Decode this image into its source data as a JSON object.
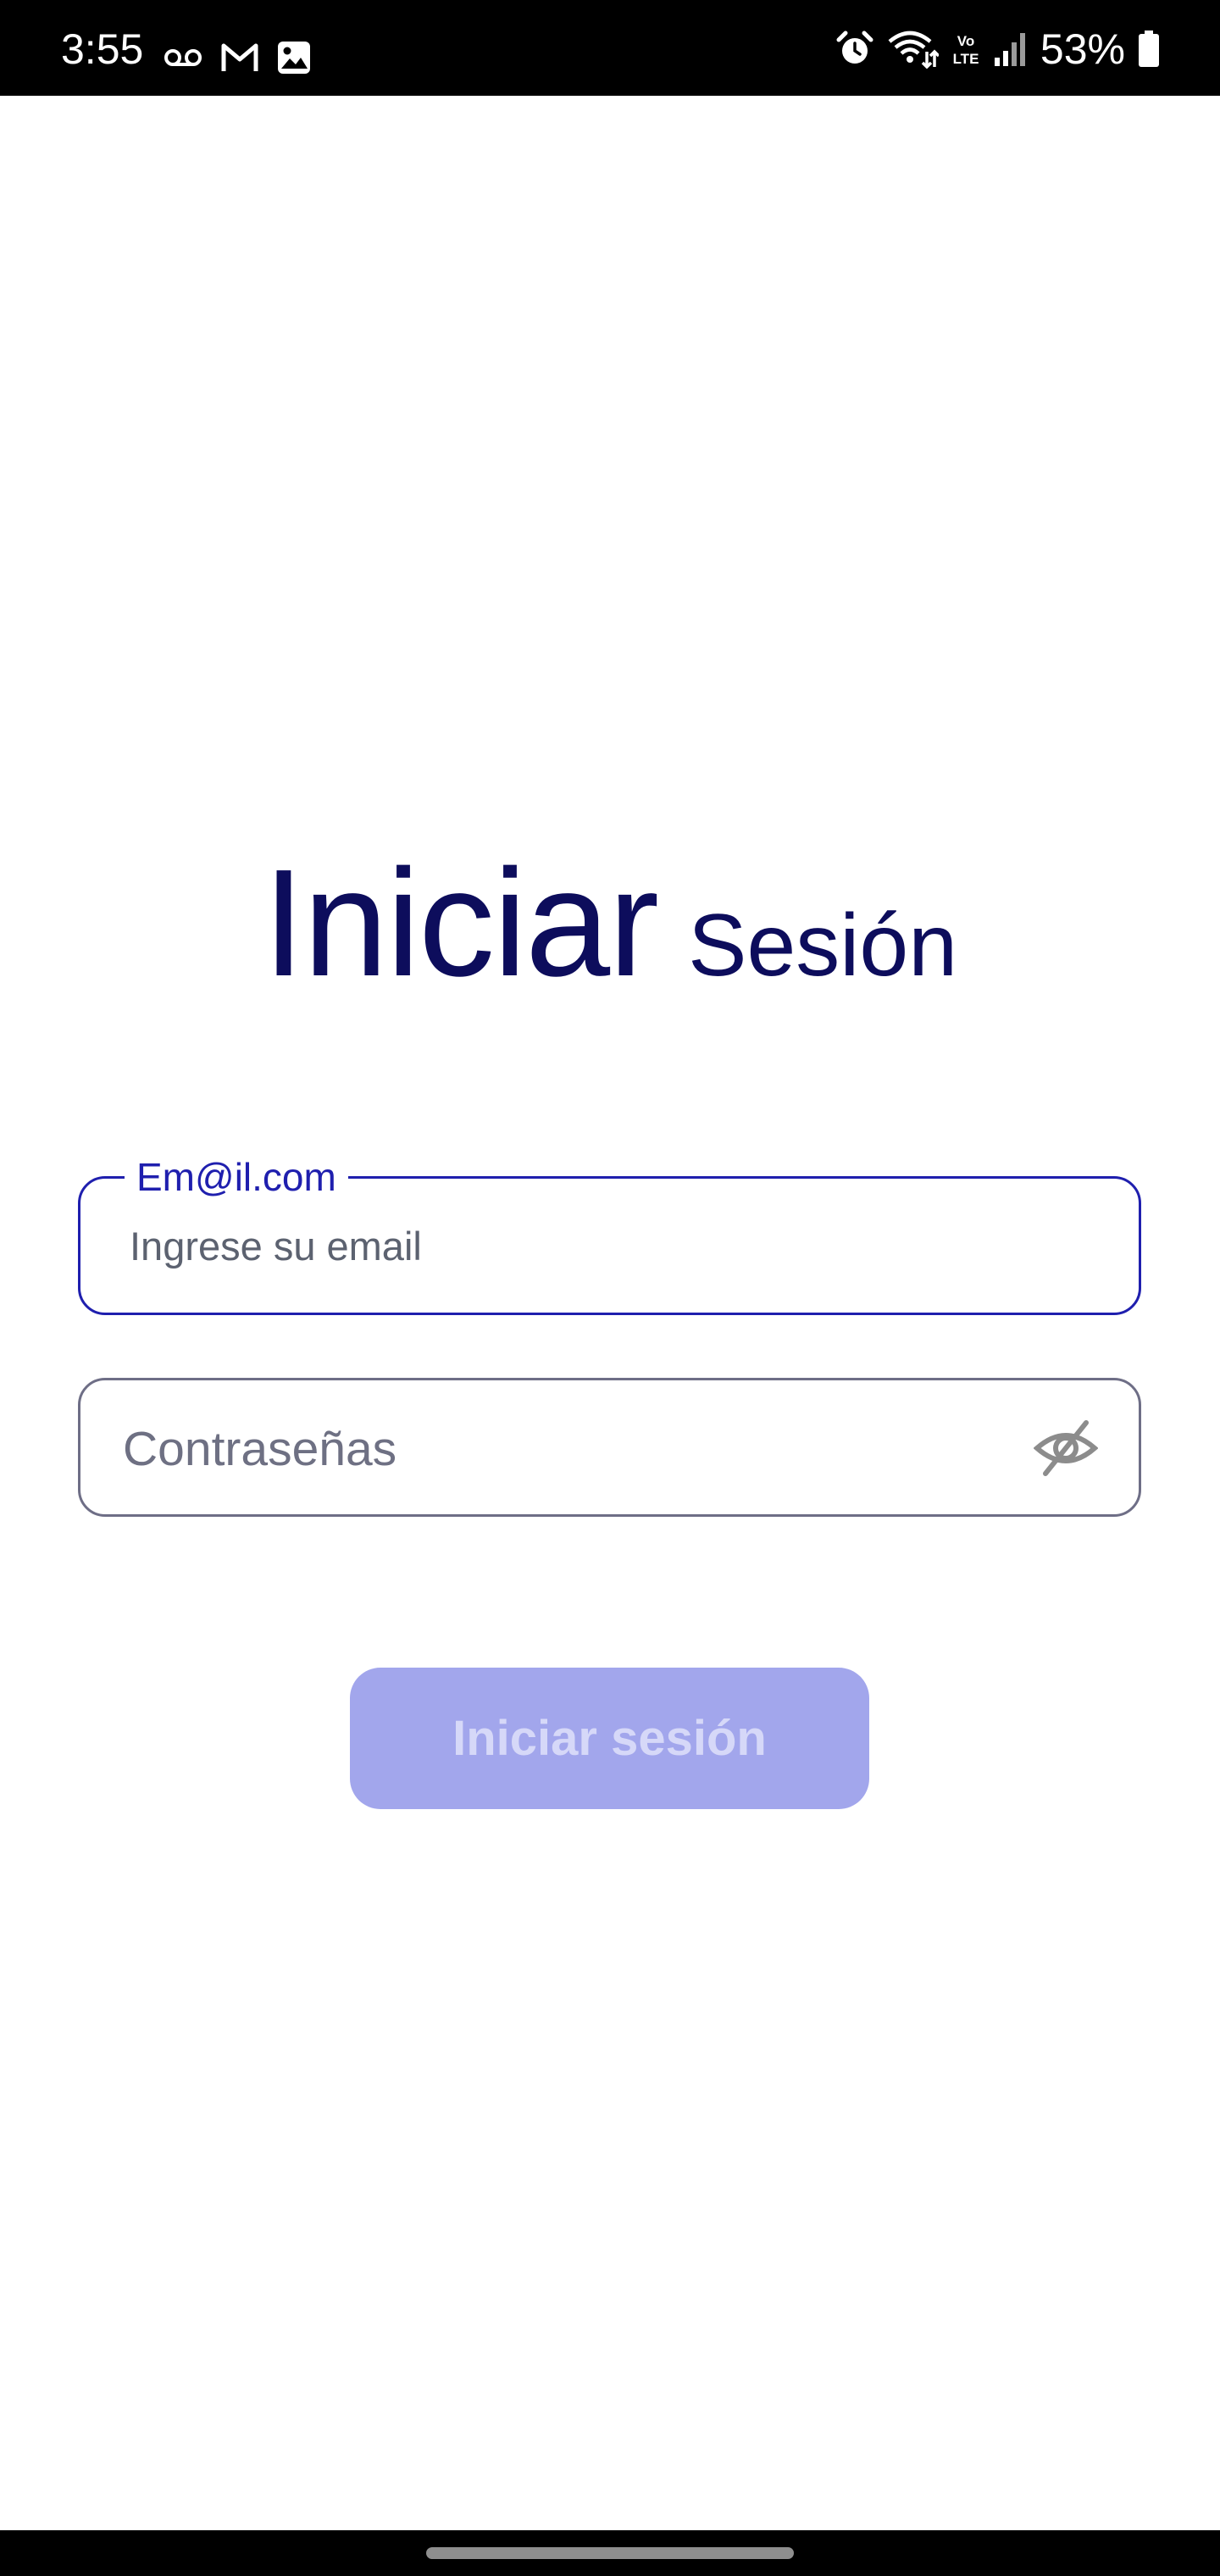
{
  "status_bar": {
    "time": "3:55",
    "battery_percent": "53%",
    "left_icons": [
      "voicemail-icon",
      "gmail-icon",
      "image-icon"
    ],
    "right_icons": [
      "alarm-icon",
      "wifi-icon",
      "volte-icon",
      "signal-icon",
      "battery-icon"
    ],
    "volte_text": {
      "line1": "Vo",
      "line2": "LTE"
    }
  },
  "login": {
    "title_main": "Iniciar",
    "title_secondary": "Sesión",
    "email": {
      "label": "Em@il.com",
      "placeholder": "Ingrese su email"
    },
    "password": {
      "placeholder": "Contraseñas",
      "visibility_icon": "eye-off-icon"
    },
    "submit_label": "Iniciar sesión"
  },
  "colors": {
    "title": "#0d0d5c",
    "focused_border": "#1f1fae",
    "button_bg": "#a2a6ec",
    "button_text": "#d6d8f8"
  }
}
